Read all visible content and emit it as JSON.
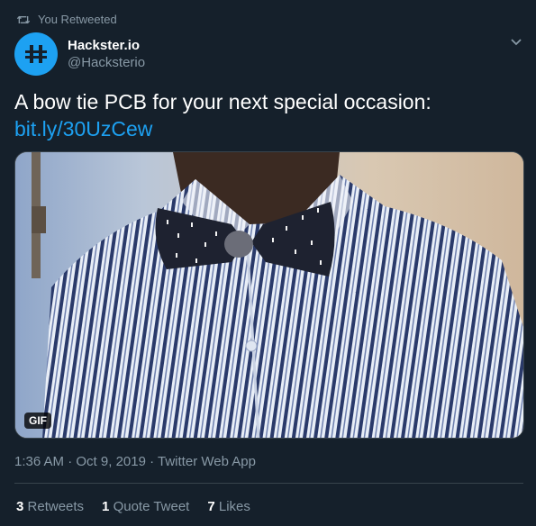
{
  "retweet": {
    "label": "You Retweeted",
    "icon": "retweet-icon"
  },
  "author": {
    "display_name": "Hackster.io",
    "handle": "@Hacksterio",
    "avatar_icon": "hackster-logo-icon",
    "avatar_color": "#1da1f2"
  },
  "menu_icon": "chevron-down-icon",
  "tweet": {
    "text": "A bow tie PCB for your next special occasion:",
    "link": "bit.ly/30UzCew"
  },
  "media": {
    "badge": "GIF"
  },
  "meta": {
    "time": "1:36 AM",
    "separator1": " · ",
    "date": "Oct 9, 2019",
    "separator2": " · ",
    "source": "Twitter Web App"
  },
  "stats": [
    {
      "count": "3",
      "label": "Retweets"
    },
    {
      "count": "1",
      "label": "Quote Tweet"
    },
    {
      "count": "7",
      "label": "Likes"
    }
  ],
  "colors": {
    "background": "#15202b",
    "accent": "#1da1f2",
    "secondary_text": "#8899a6",
    "divider": "#38444d"
  }
}
